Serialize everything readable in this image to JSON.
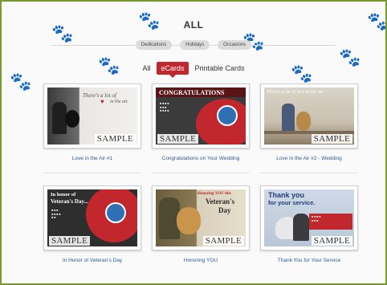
{
  "page": {
    "title": "ALL"
  },
  "filters": [
    {
      "label": "Dedications"
    },
    {
      "label": "Holidays"
    },
    {
      "label": "Occasions"
    }
  ],
  "tabs": [
    {
      "label": "All",
      "active": false
    },
    {
      "label": "eCards",
      "active": true
    },
    {
      "label": "Printable Cards",
      "active": false
    }
  ],
  "sample_label": "SAMPLE",
  "cards": [
    {
      "label": "Love in the Air #1",
      "art_text_1": "There's a lot of",
      "art_text_2": "in the air."
    },
    {
      "label": "Congratulations on Your Wedding",
      "art_text_1": "CONGRATULATIONS"
    },
    {
      "label": "Love in the Air #2 - Wedding",
      "art_text_1": "There's a lot of love in the air."
    },
    {
      "label": "In Honor of Veteran's Day",
      "art_text_1": "In honor of",
      "art_text_2": "Veteran's Day..."
    },
    {
      "label": "Honoring YOU",
      "art_text_1": "Honoring YOU this",
      "art_text_2": "Veteran's",
      "art_text_3": "Day"
    },
    {
      "label": "Thank You for Your Service",
      "art_text_1": "Thank you",
      "art_text_2": "for your service."
    }
  ],
  "colors": {
    "frame": "#7a9a2e",
    "accent": "#c2272d",
    "link": "#2d5a99"
  }
}
